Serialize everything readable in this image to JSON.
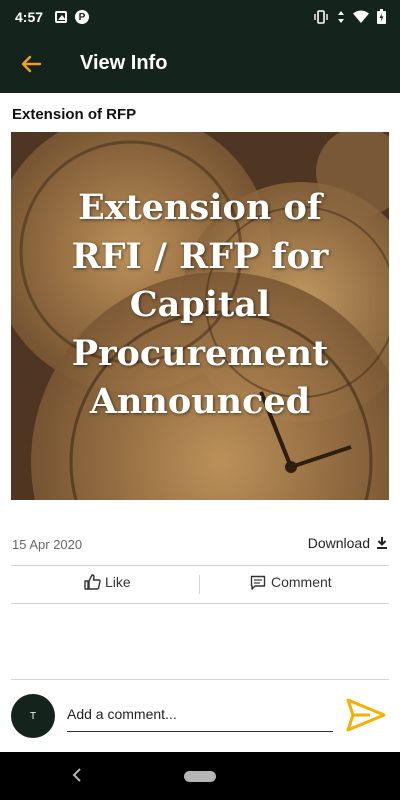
{
  "status_bar": {
    "time": "4:57",
    "left_icons": [
      "image-icon",
      "p-icon"
    ],
    "right_icons": [
      "vibrate-icon",
      "data-arrows-icon",
      "wifi-icon",
      "battery-icon"
    ],
    "p_glyph": "P"
  },
  "app_bar": {
    "title": "View Info",
    "back_icon": "arrow-left-icon",
    "back_color": "#f0a020",
    "background": "#14231c"
  },
  "post": {
    "title": "Extension of RFP",
    "banner_lines": [
      "Extension of",
      "RFI / RFP for",
      "Capital",
      "Procurement",
      "Announced"
    ],
    "date": "15 Apr 2020",
    "download_label": "Download"
  },
  "actions": {
    "like_label": "Like",
    "comment_label": "Comment"
  },
  "comment_box": {
    "avatar_initial": "T",
    "placeholder": "Add a comment...",
    "send_color": "#f5b000"
  }
}
